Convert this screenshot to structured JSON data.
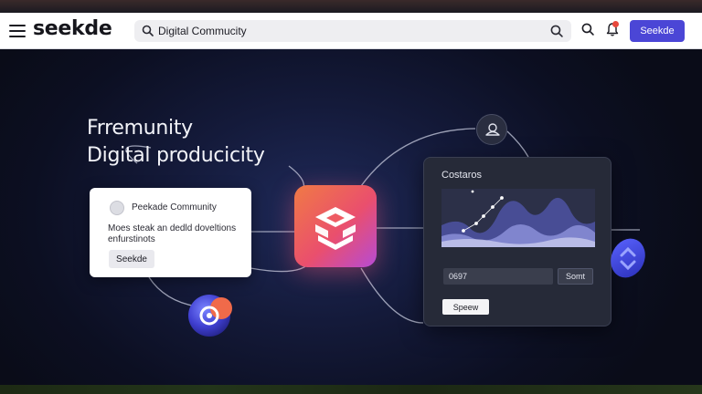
{
  "navbar": {
    "logo": "seekde",
    "search": {
      "value": "Digital Commucity"
    },
    "cta_label": "Seekde",
    "icons": [
      "menu-icon",
      "search-icon",
      "notification-bell-icon"
    ]
  },
  "hero": {
    "headline": [
      "Frremunity",
      "Digital producicity"
    ]
  },
  "community_card": {
    "title": "Peekade Community",
    "description": "Moes steak an dedld doveltions enfurstinots",
    "button_label": "Seekde"
  },
  "panel": {
    "title": "Costaros",
    "input_value": "0697",
    "right_button_label": "Somt",
    "save_button_label": "Speew"
  },
  "colors": {
    "accent": "#4b46d6",
    "app_gradient_start": "#f07a45",
    "app_gradient_end": "#b64bd4",
    "background": "#0b0d18",
    "panel": "#262a38"
  }
}
